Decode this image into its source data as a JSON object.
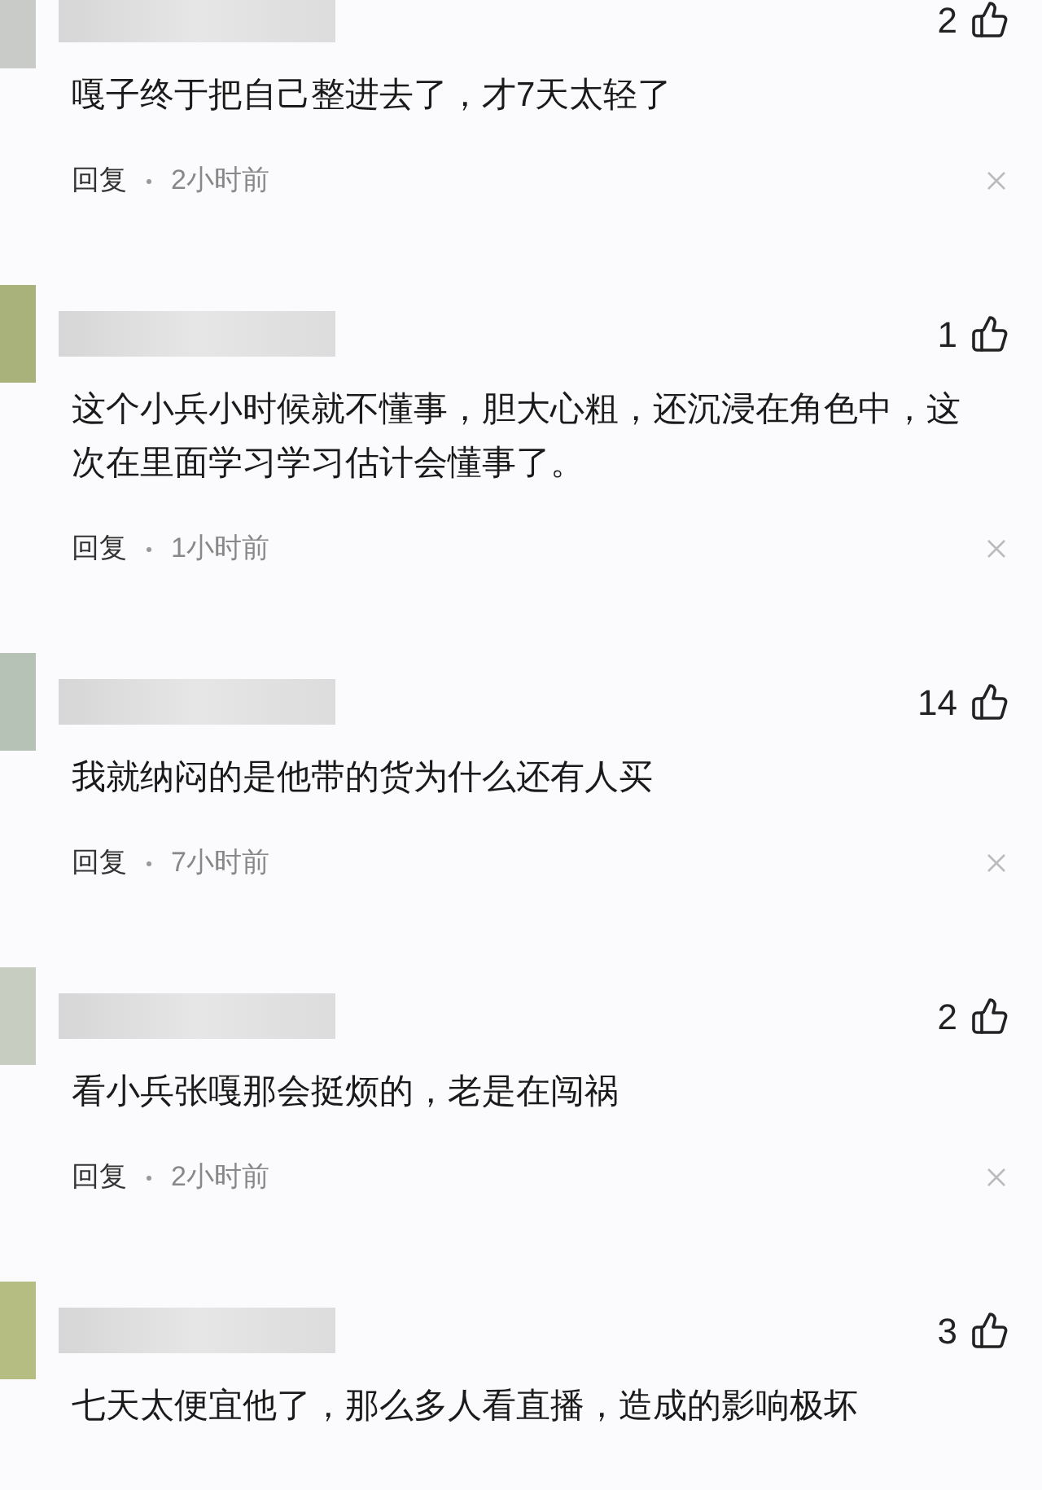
{
  "comments": [
    {
      "likes": "2",
      "text": "嘎子终于把自己整进去了，才7天太轻了",
      "reply": "回复",
      "time": "2小时前"
    },
    {
      "likes": "1",
      "text": "这个小兵小时候就不懂事，胆大心粗，还沉浸在角色中，这次在里面学习学习估计会懂事了。",
      "reply": "回复",
      "time": "1小时前"
    },
    {
      "likes": "14",
      "text": "我就纳闷的是他带的货为什么还有人买",
      "reply": "回复",
      "time": "7小时前"
    },
    {
      "likes": "2",
      "text": "看小兵张嘎那会挺烦的，老是在闯祸",
      "reply": "回复",
      "time": "2小时前"
    },
    {
      "likes": "3",
      "text": "七天太便宜他了，那么多人看直播，造成的影响极坏"
    }
  ]
}
